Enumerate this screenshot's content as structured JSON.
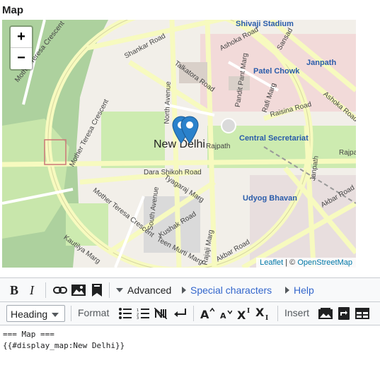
{
  "section": {
    "heading": "Map"
  },
  "map": {
    "zoom_in": "+",
    "zoom_out": "−",
    "attribution_leaflet": "Leaflet",
    "attribution_sep": " | © ",
    "attribution_osm": "OpenStreetMap",
    "labels": {
      "new_delhi": "New Delhi",
      "shivaji_stadium": "Shivaji Stadium",
      "janpath_top": "Janpath",
      "patel_chowk": "Patel Chowk",
      "central_secretariat": "Central Secretariat",
      "udyog_bhavan": "Udyog Bhavan",
      "shankar_road": "Shankar Road",
      "ashoka_road_top": "Ashoka Road",
      "ashoka_road_right": "Ashoka Road",
      "sansad": "Sansad",
      "talkatora_road": "Talkatora Road",
      "pandit_pant_marg": "Pandit Pant Marg",
      "north_avenue": "North Avenue",
      "rafi_marg": "Rafi Marg",
      "raisina_road": "Raisina Road",
      "mother_teresa_crescent_top": "Mother Teresa Crescent",
      "mother_teresa_crescent_bottom": "Mother Teresa Crescent",
      "rajpath": "Rajpath",
      "rajpath_right": "Rajpath",
      "dara_shikoh_road": "Dara Shikoh Road",
      "tyagaraj_marg": "Tyagaraj Marg",
      "south_avenue": "South Avenue",
      "kushak_road": "Kushak Road",
      "teen_murti_marg": "Teen Murti Marg",
      "kautilya_marg": "Kautilya Marg",
      "rajaji_marg": "Rajaji Marg",
      "akbar_road_bottom": "Akbar Road",
      "akbar_road_right": "Akbar Road",
      "janpath_right": "Janpath"
    }
  },
  "editor": {
    "toolbar1": {
      "bold": "B",
      "italic": "I",
      "advanced": "Advanced",
      "special_characters": "Special characters",
      "help": "Help"
    },
    "toolbar2": {
      "heading_select": "Heading",
      "format_label": "Format",
      "insert_label": "Insert"
    },
    "content": "=== Map ===\n{{#display_map:New Delhi}}"
  },
  "colors": {
    "link": "#3366cc",
    "marker": "#2a81cb",
    "road_major": "#f7fabf",
    "park": "#cdebb0"
  }
}
